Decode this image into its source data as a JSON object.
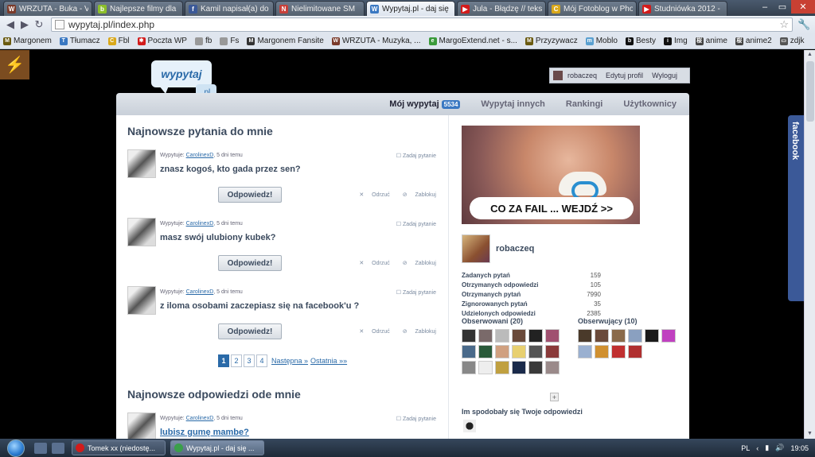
{
  "browser": {
    "tabs": [
      {
        "title": "WRZUTA - Buka - V",
        "color": "#7a3a2a",
        "glyph": "W"
      },
      {
        "title": "Najlepsze filmy dla",
        "color": "#8cbf2a",
        "glyph": "b"
      },
      {
        "title": "Kamil napisał(a) do",
        "color": "#3b5998",
        "glyph": "f"
      },
      {
        "title": "Nielimitowane SM",
        "color": "#c8403a",
        "glyph": "N"
      },
      {
        "title": "Wypytaj.pl - daj się",
        "color": "#3a78c2",
        "glyph": "W",
        "active": true
      },
      {
        "title": "Jula - Błądzę // tekst",
        "color": "#d21b1b",
        "glyph": "▶"
      },
      {
        "title": "Mój Fotoblog w Pho",
        "color": "#d9a81a",
        "glyph": "C"
      },
      {
        "title": "Studniówka 2012 -",
        "color": "#d21b1b",
        "glyph": "▶"
      }
    ],
    "address": "wypytaj.pl/index.php",
    "bookmarks": [
      {
        "label": "Margonem",
        "color": "#6a5a10",
        "glyph": "M"
      },
      {
        "label": "Tłumacz",
        "color": "#3a78c2",
        "glyph": "T"
      },
      {
        "label": "Fbl",
        "color": "#d9a81a",
        "glyph": "C"
      },
      {
        "label": "Poczta WP",
        "color": "#d21b1b",
        "glyph": "✱"
      },
      {
        "label": "fb",
        "color": "#999",
        "glyph": ""
      },
      {
        "label": "Fs",
        "color": "#999",
        "glyph": ""
      },
      {
        "label": "Margonem Fansite",
        "color": "#333",
        "glyph": "M"
      },
      {
        "label": "WRZUTA - Muzyka, ...",
        "color": "#7a3a2a",
        "glyph": "W"
      },
      {
        "label": "MargoExtend.net - s...",
        "color": "#3a9a3a",
        "glyph": "e"
      },
      {
        "label": "Przyzywacz",
        "color": "#6a5a10",
        "glyph": "M"
      },
      {
        "label": "Moblo",
        "color": "#5aa0d0",
        "glyph": "m"
      },
      {
        "label": "Besty",
        "color": "#111",
        "glyph": "b"
      },
      {
        "label": "Img",
        "color": "#111",
        "glyph": "i"
      },
      {
        "label": "anime",
        "color": "#444",
        "glyph": "桜"
      },
      {
        "label": "anime2",
        "color": "#444",
        "glyph": "桜"
      },
      {
        "label": "zdjk",
        "color": "#555",
        "glyph": "▭"
      }
    ]
  },
  "site": {
    "logo": "wypytaj",
    "logo_suffix": ".pl",
    "user_menu": {
      "username": "robaczeq",
      "edit": "Edytuj profil",
      "logout": "Wyloguj"
    },
    "nav": [
      {
        "label": "Mój wypytaj",
        "badge": "5534",
        "active": true
      },
      {
        "label": "Wypytaj innych"
      },
      {
        "label": "Rankingi"
      },
      {
        "label": "Użytkownicy"
      }
    ],
    "questions_heading": "Najnowsze pytania do mnie",
    "asked_by_label": "Wypytuje:",
    "ask_link": "Zadaj pytanie",
    "answer_button": "Odpowiedz!",
    "reject": "Odrzuć",
    "block": "Zablokuj",
    "questions": [
      {
        "author": "CarolinexD",
        "when": ", 5 dni temu",
        "text": "znasz kogoś, kto gada przez sen?"
      },
      {
        "author": "CarolinexD",
        "when": ", 5 dni temu",
        "text": "masz swój ulubiony kubek?"
      },
      {
        "author": "CarolinexD",
        "when": ", 5 dni temu",
        "text": "z iloma osobami zaczepiasz się na facebook'u ?"
      }
    ],
    "pagination": {
      "pages": [
        "1",
        "2",
        "3",
        "4"
      ],
      "next": "Następna »",
      "last": "Ostatnia »»"
    },
    "answers_heading": "Najnowsze odpowiedzi ode mnie",
    "answers": [
      {
        "author": "CarolinexD",
        "when": ", 5 dni temu",
        "text": "lubisz gumę mambe?"
      }
    ],
    "ad_text": "CO ZA FAIL ... WEJDŹ >>",
    "profile": {
      "name": "robaczeq",
      "stats": [
        {
          "label": "Zadanych pytań",
          "value": "159"
        },
        {
          "label": "Otrzymanych odpowiedzi",
          "value": "105"
        },
        {
          "label": "Otrzymanych pytań",
          "value": "7990"
        },
        {
          "label": "Zignorowanych pytań",
          "value": "35"
        },
        {
          "label": "Udzielonych odpowiedzi",
          "value": "2385"
        }
      ],
      "following_label": "Obserwowani (20)",
      "followers_label": "Obserwujący (10)",
      "liked_label": "Im spodobały się Twoje odpowiedzi"
    },
    "facebook_tab": "facebook"
  },
  "taskbar": {
    "tasks": [
      {
        "title": "Tomek xx (niedostę...",
        "color": "#d21b1b"
      },
      {
        "title": "Wypytaj.pl - daj się ...",
        "color": "#3aa04a",
        "active": true
      }
    ],
    "lang": "PL",
    "time": "19:05"
  }
}
